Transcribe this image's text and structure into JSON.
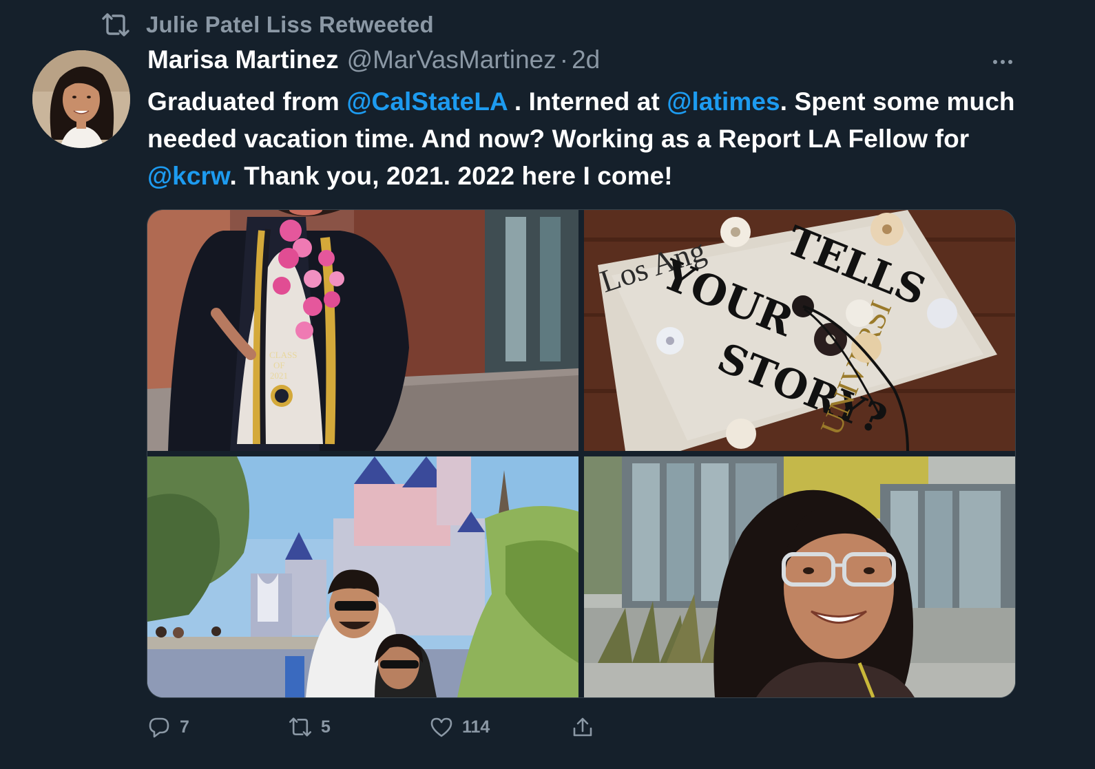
{
  "retweet": {
    "icon": "retweet-icon",
    "text": "Julie Patel Liss Retweeted"
  },
  "author": {
    "display_name": "Marisa Martinez",
    "handle": "@MarVasMartinez",
    "separator": "·",
    "time": "2d",
    "avatar_icon": "avatar-photo"
  },
  "more_icon": "more-icon",
  "text": {
    "p1": "Graduated from ",
    "m1": "@CalStateLA",
    "p2": " . Interned at ",
    "m2": "@latimes",
    "p3": ". Spent some much needed vacation time. And now? Working as a Report LA Fellow for ",
    "m3": "@kcrw",
    "p4": ". Thank you, 2021. 2022 here I come!"
  },
  "media": {
    "photo1": {
      "stole_lines": [
        "CLASS",
        "OF",
        "2021"
      ]
    },
    "photo2": {
      "words": [
        "TELLS",
        "YOUR",
        "STORY?",
        "Los Ang",
        "UNIVERSI"
      ]
    },
    "photo3": {},
    "photo4": {}
  },
  "actions": {
    "reply": {
      "icon": "reply-icon",
      "count": "7"
    },
    "retweet": {
      "icon": "retweet-icon",
      "count": "5"
    },
    "like": {
      "icon": "heart-icon",
      "count": "114"
    },
    "share": {
      "icon": "share-icon"
    }
  },
  "colors": {
    "background": "#15202b",
    "text": "#ffffff",
    "muted": "#8b98a5",
    "link": "#1d9bf0"
  }
}
